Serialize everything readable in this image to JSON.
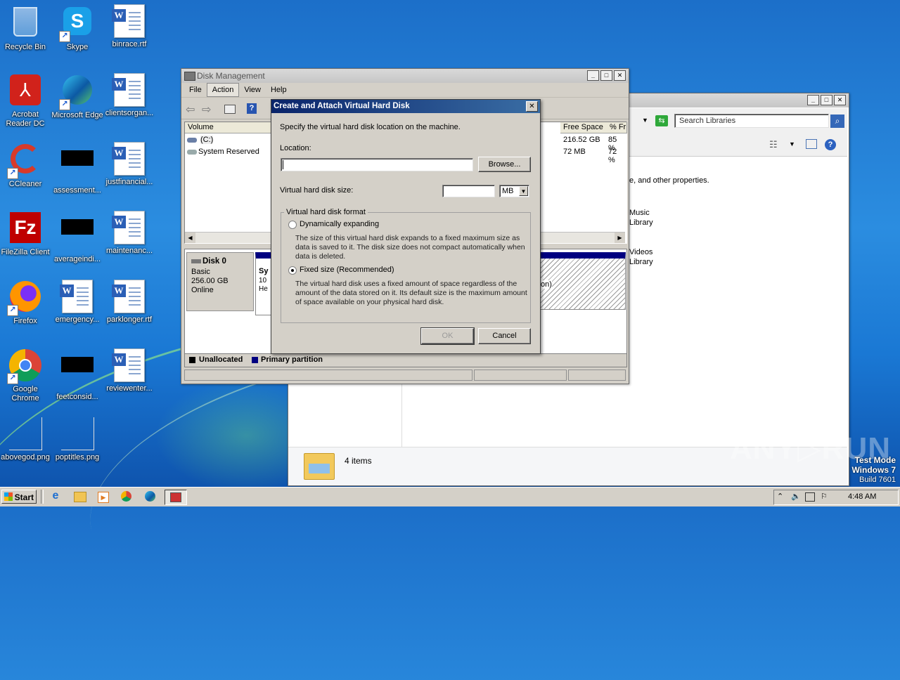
{
  "desktop": {
    "icons": [
      {
        "label": "Recycle Bin"
      },
      {
        "label": "Skype"
      },
      {
        "label": "binrace.rtf"
      },
      {
        "label": "Acrobat Reader DC"
      },
      {
        "label": "Microsoft Edge"
      },
      {
        "label": "clientsorgan..."
      },
      {
        "label": "CCleaner"
      },
      {
        "label": "assessment..."
      },
      {
        "label": "justfinancial..."
      },
      {
        "label": "FileZilla Client"
      },
      {
        "label": "averageindi..."
      },
      {
        "label": "maintenanc..."
      },
      {
        "label": "Firefox"
      },
      {
        "label": "emergency..."
      },
      {
        "label": "parklonger.rtf"
      },
      {
        "label": "Google Chrome"
      },
      {
        "label": "feetconsid..."
      },
      {
        "label": "reviewenter..."
      },
      {
        "label": "abovegod.png"
      },
      {
        "label": "poptitles.png"
      }
    ],
    "watermark": {
      "brand": "ANY▷RUN",
      "line1": "Test Mode",
      "line2": "Windows 7",
      "line3": "Build 7601"
    }
  },
  "explorer": {
    "search_placeholder": "Search Libraries",
    "body_text": "e, and other properties.",
    "libraries": [
      {
        "name": "Music",
        "type": "Library"
      },
      {
        "name": "Videos",
        "type": "Library"
      }
    ],
    "status_items": "4 items"
  },
  "disk_mgmt": {
    "title": "Disk Management",
    "menu": [
      "File",
      "Action",
      "View",
      "Help"
    ],
    "active_menu": "Action",
    "columns": {
      "volume": "Volume",
      "free_space": "Free Space",
      "pct_free": "% Fr"
    },
    "volumes": [
      {
        "name": "(C:)",
        "free": "216.52 GB",
        "pct": "85 %"
      },
      {
        "name": "System Reserved",
        "free": "72 MB",
        "pct": "72 %"
      }
    ],
    "disk": {
      "name": "Disk 0",
      "type": "Basic",
      "size": "256.00 GB",
      "status": "Online"
    },
    "partition_snippet": {
      "l1": "Sy",
      "l2": "10",
      "l3": "He",
      "right": "on)"
    },
    "legend": {
      "unallocated": "Unallocated",
      "primary": "Primary partition"
    },
    "colors": {
      "unallocated": "#000000",
      "primary": "#000080"
    }
  },
  "dialog": {
    "title": "Create and Attach Virtual Hard Disk",
    "instruction": "Specify the virtual hard disk location on the machine.",
    "location_label": "Location:",
    "location_value": "",
    "browse_button": "Browse...",
    "size_label": "Virtual hard disk size:",
    "size_value": "",
    "size_unit": "MB",
    "format_group": "Virtual hard disk format",
    "dynamic_label": "Dynamically expanding",
    "dynamic_desc": "The size of this virtual hard disk expands to a fixed maximum size as data is saved to it.  The disk size does not compact automatically when data is deleted.",
    "fixed_label": "Fixed size (Recommended)",
    "fixed_desc": "The virtual hard disk uses a fixed amount of space regardless of the amount of the data stored on it.  Its default size is the maximum amount of space available on your physical hard disk.",
    "selected_format": "fixed",
    "ok_button": "OK",
    "cancel_button": "Cancel"
  },
  "taskbar": {
    "start_label": "Start",
    "time": "4:48 AM"
  }
}
